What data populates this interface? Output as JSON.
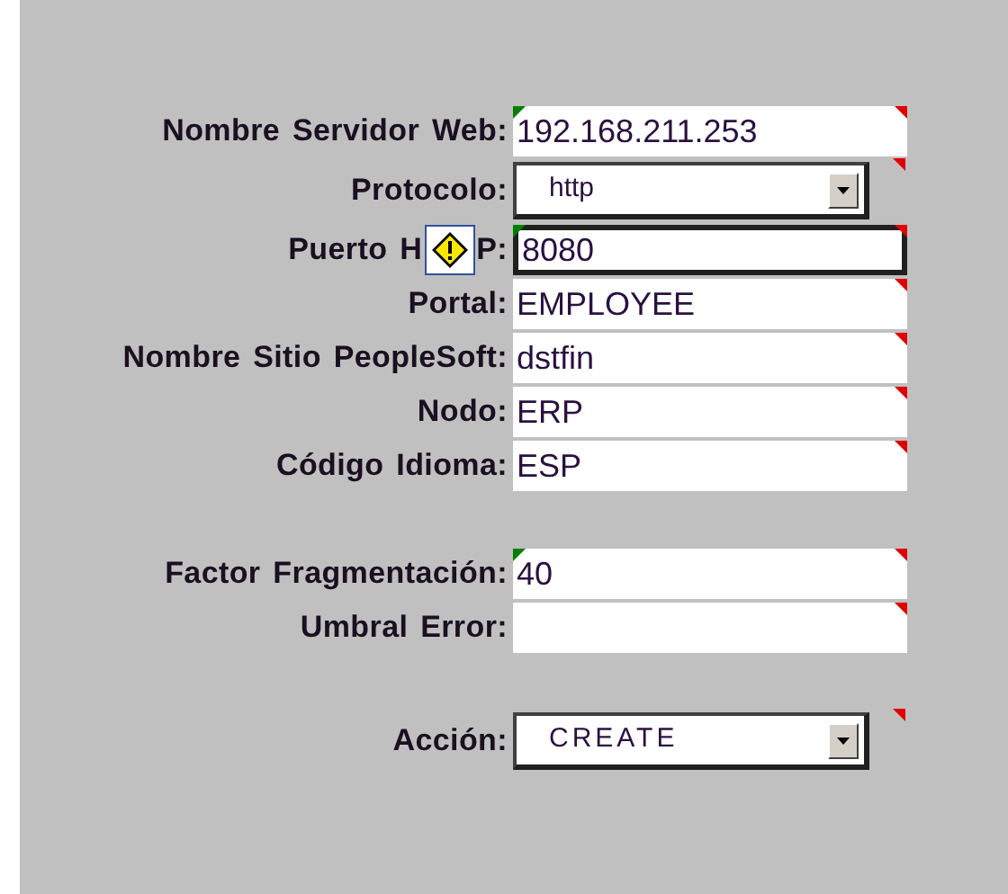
{
  "groups": [
    {
      "rows": [
        {
          "kind": "text",
          "label": "Nombre Servidor Web:",
          "value": "192.168.211.253",
          "comment": true,
          "error": true,
          "selected": false
        },
        {
          "kind": "dropdown",
          "label": "Protocolo:",
          "value": "http",
          "comment": true,
          "error": false,
          "selected": false
        },
        {
          "kind": "warned",
          "label_before": "Puerto H",
          "label_after": "P:",
          "value": "8080",
          "comment": true,
          "error": true,
          "selected": true
        },
        {
          "kind": "text",
          "label": "Portal:",
          "value": "EMPLOYEE",
          "comment": true,
          "error": false,
          "selected": false
        },
        {
          "kind": "text",
          "label": "Nombre Sitio PeopleSoft:",
          "value": "dstfin",
          "comment": true,
          "error": false,
          "selected": false
        },
        {
          "kind": "text",
          "label": "Nodo:",
          "value": "ERP",
          "comment": true,
          "error": false,
          "selected": false
        },
        {
          "kind": "text",
          "label": "Código Idioma:",
          "value": "ESP",
          "comment": true,
          "error": false,
          "selected": false
        }
      ]
    },
    {
      "rows": [
        {
          "kind": "text",
          "label": "Factor Fragmentación:",
          "value": "40",
          "comment": true,
          "error": true,
          "selected": false
        },
        {
          "kind": "text",
          "label": "Umbral Error:",
          "comment": true,
          "error": false,
          "selected": false
        }
      ]
    },
    {
      "rows": [
        {
          "kind": "dropdown",
          "label": "Acción:",
          "value": "CREATE",
          "comment": true,
          "error": false,
          "selected": false
        }
      ]
    }
  ]
}
